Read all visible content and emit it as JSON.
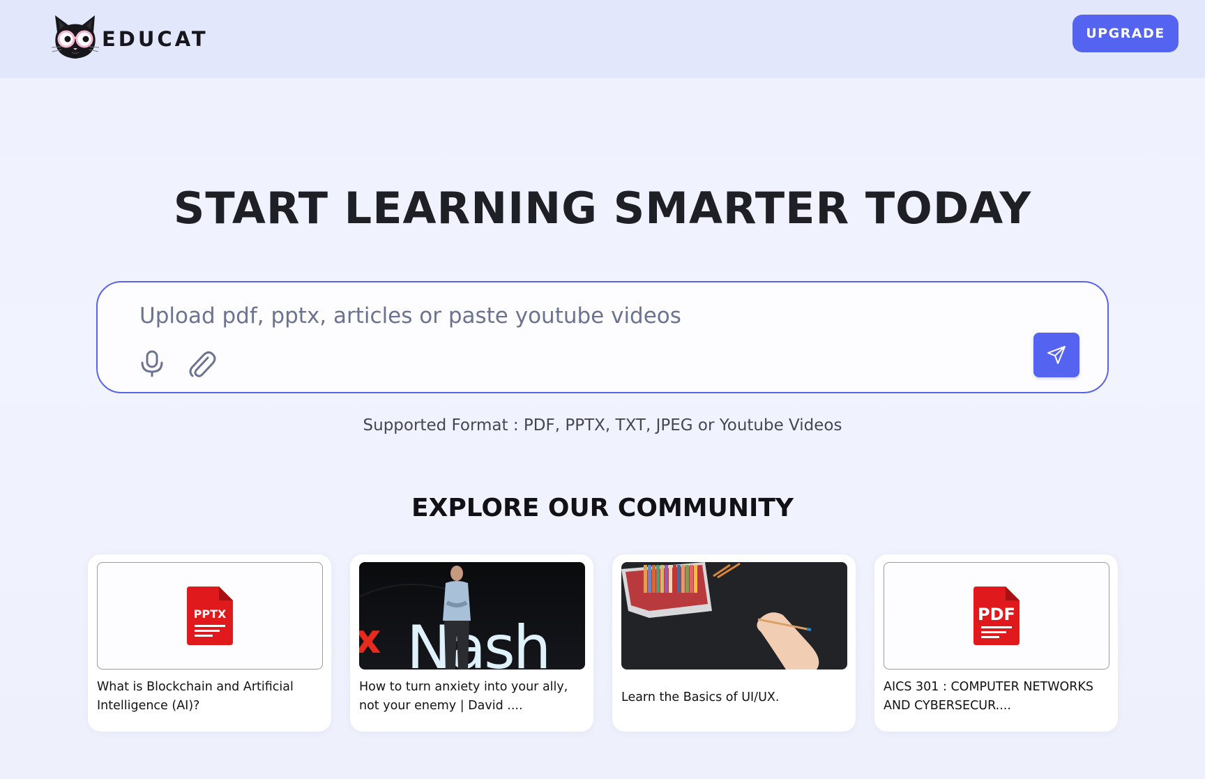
{
  "header": {
    "brand": "EDUCAT",
    "upgrade_label": "UPGRADE"
  },
  "hero": {
    "title": "START LEARNING SMARTER TODAY"
  },
  "upload": {
    "placeholder": "Upload pdf, pptx, articles or paste youtube videos",
    "value": "",
    "supported_formats": "Supported Format : PDF, PPTX, TXT, JPEG or Youtube Videos"
  },
  "community": {
    "title": "EXPLORE OUR COMMUNITY",
    "cards": [
      {
        "thumb_type": "file",
        "file_label": "PPTX",
        "title": "What is Blockchain and Artificial Intelligence (AI)?"
      },
      {
        "thumb_type": "image",
        "image_text": "x Nash",
        "title": "How to turn anxiety into your ally, not your enemy | David ...."
      },
      {
        "thumb_type": "image",
        "title": "Learn the Basics of UI/UX."
      },
      {
        "thumb_type": "file",
        "file_label": "PDF",
        "title": "AICS 301 : COMPUTER NETWORKS AND CYBERSECUR...."
      }
    ]
  },
  "colors": {
    "accent": "#5463f0",
    "header_bg": "#e2e7fc",
    "page_bg": "#eef1fd",
    "file_icon_red": "#e0191c",
    "ted_red": "#e62b1e"
  },
  "icons": [
    "cat-logo-icon",
    "microphone-icon",
    "paperclip-icon",
    "send-icon",
    "pptx-file-icon",
    "pdf-file-icon"
  ]
}
